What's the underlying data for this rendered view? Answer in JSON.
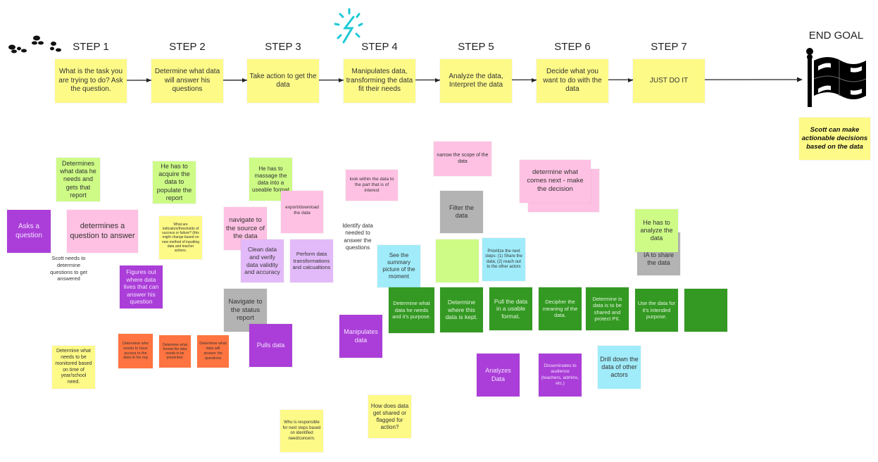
{
  "steps": {
    "labels": [
      "STEP 1",
      "STEP 2",
      "STEP 3",
      "STEP 4",
      "STEP 5",
      "STEP 6",
      "STEP 7"
    ],
    "notes": [
      "What is the task you are trying to do? Ask the question.",
      "Determine what data will answer his questions",
      "Take action to get the data",
      "Manipulates data, transforming the data fit their needs",
      "Analyze the data, Interpret the data",
      "Decide what you want to do with the data",
      "JUST DO IT"
    ]
  },
  "end_goal": {
    "label": "END GOAL",
    "note": "Scott can make actionable decisions based on the data"
  },
  "notes": [
    "Determines what data he needs and gets that report",
    "Asks a question",
    "determines a question to answer",
    "Scott needs to determine questions to get answered",
    "He has to acquire the data to populate the report",
    "What are indicators/thresholds of success or failure? (this might change based on new method of inputting data and teacher actions.",
    "Figures out where data lives that can answer his question",
    "Determine what needs to be monitored based on time of year/school need.",
    "Determine who needs to have access to the data in his org",
    "Determine what format the data needs to be presented.",
    "Determine what data will answer his questions",
    "He has to massage the data into a useable format",
    "navigate to the source of the data",
    "export/download the data",
    "Clean data and verify data validity and accuracy",
    "Perform data transformations and calcualtions",
    "Navigate to the status report",
    "Pulls data",
    "look within the data to the part that is of interest",
    "Identify data needed to answer the questions",
    "See the summary picture of the moment",
    "Manipulates data",
    "Determine what data he needs and it's purpose.",
    "How does data get shared or flagged for action?",
    "Who is responsible for next steps based on identified need/concern.",
    "narrow the scope of the data",
    "Filter the data",
    "",
    "Prioritize the next steps: (1) Share the data; (2) reach out to the other actors",
    "Determine where this data is kept.",
    "Pull the data in a usable format.",
    "Decipher the meaning of the data.",
    "Determine is data is to be shared and protect PII.",
    "Use the data for it's intended purpose.",
    "",
    "Analyzes Data",
    "Disseminates to audience (teachers, admins, etc.)",
    "Drill down the data of other actors",
    "",
    "determine what comes next - make the decision",
    "IA to share the data",
    "He has to analyze the data"
  ],
  "icons": [
    "footprints-icon",
    "lightning-icon",
    "checkered-flag-icon"
  ],
  "colors": {
    "yellow": "#fdfa87",
    "pink": "#ffc1e3",
    "lime": "#cdfb86",
    "purple": "#ab3ed8",
    "grey": "#b3b3b3",
    "orange": "#ff7440",
    "green": "#339922",
    "cyan": "#a0ecfb",
    "lavender": "#e3baf9",
    "lightning": "#1cc9d6"
  }
}
